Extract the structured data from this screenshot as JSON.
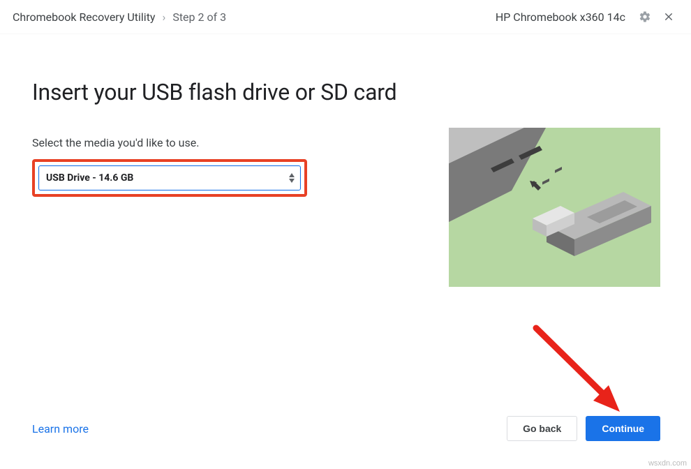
{
  "header": {
    "app_title": "Chromebook Recovery Utility",
    "separator": "›",
    "step_label": "Step 2 of 3",
    "device_name": "HP Chromebook x360 14c"
  },
  "main": {
    "heading": "Insert your USB flash drive or SD card",
    "prompt": "Select the media you'd like to use.",
    "selected_media": "USB Drive - 14.6 GB"
  },
  "footer": {
    "learn_more": "Learn more",
    "go_back": "Go back",
    "continue": "Continue"
  },
  "watermark": "wsxdn.com"
}
